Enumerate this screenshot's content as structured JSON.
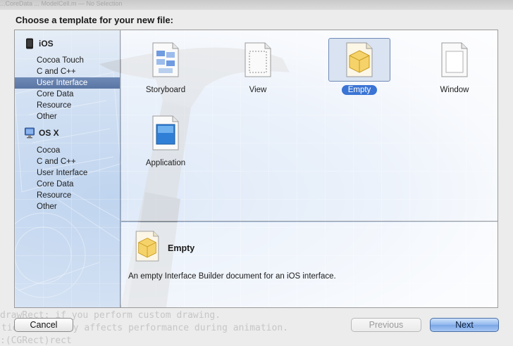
{
  "window": {
    "ghost_title": "...CoreData ... ModelCell.m — No Selection",
    "heading": "Choose a template for your new file:"
  },
  "background_code": [
    "drawRect: if you perform custom drawing.",
    "tion adversely affects performance during animation.",
    ":(CGRect)rect"
  ],
  "sidebar": {
    "sections": [
      {
        "title": "iOS",
        "icon": "iphone-icon",
        "items": [
          "Cocoa Touch",
          "C and C++",
          "User Interface",
          "Core Data",
          "Resource",
          "Other"
        ],
        "selected": "User Interface"
      },
      {
        "title": "OS X",
        "icon": "mac-finder-icon",
        "items": [
          "Cocoa",
          "C and C++",
          "User Interface",
          "Core Data",
          "Resource",
          "Other"
        ]
      }
    ]
  },
  "templates": [
    {
      "label": "Storyboard",
      "icon": "storyboard-document-icon"
    },
    {
      "label": "View",
      "icon": "view-document-icon"
    },
    {
      "label": "Empty",
      "icon": "empty-cube-document-icon",
      "selected": true
    },
    {
      "label": "Window",
      "icon": "window-document-icon"
    },
    {
      "label": "Application",
      "icon": "application-document-icon"
    }
  ],
  "detail": {
    "title": "Empty",
    "description": "An empty Interface Builder document for an iOS interface.",
    "icon": "empty-cube-document-icon"
  },
  "buttons": {
    "cancel": "Cancel",
    "previous": "Previous",
    "next": "Next",
    "previous_enabled": false
  },
  "colors": {
    "selection": "#6f8ab6",
    "selected_label": "#3a74d4",
    "default_button": "#8fb6ee",
    "cube": "#f2c24a"
  }
}
